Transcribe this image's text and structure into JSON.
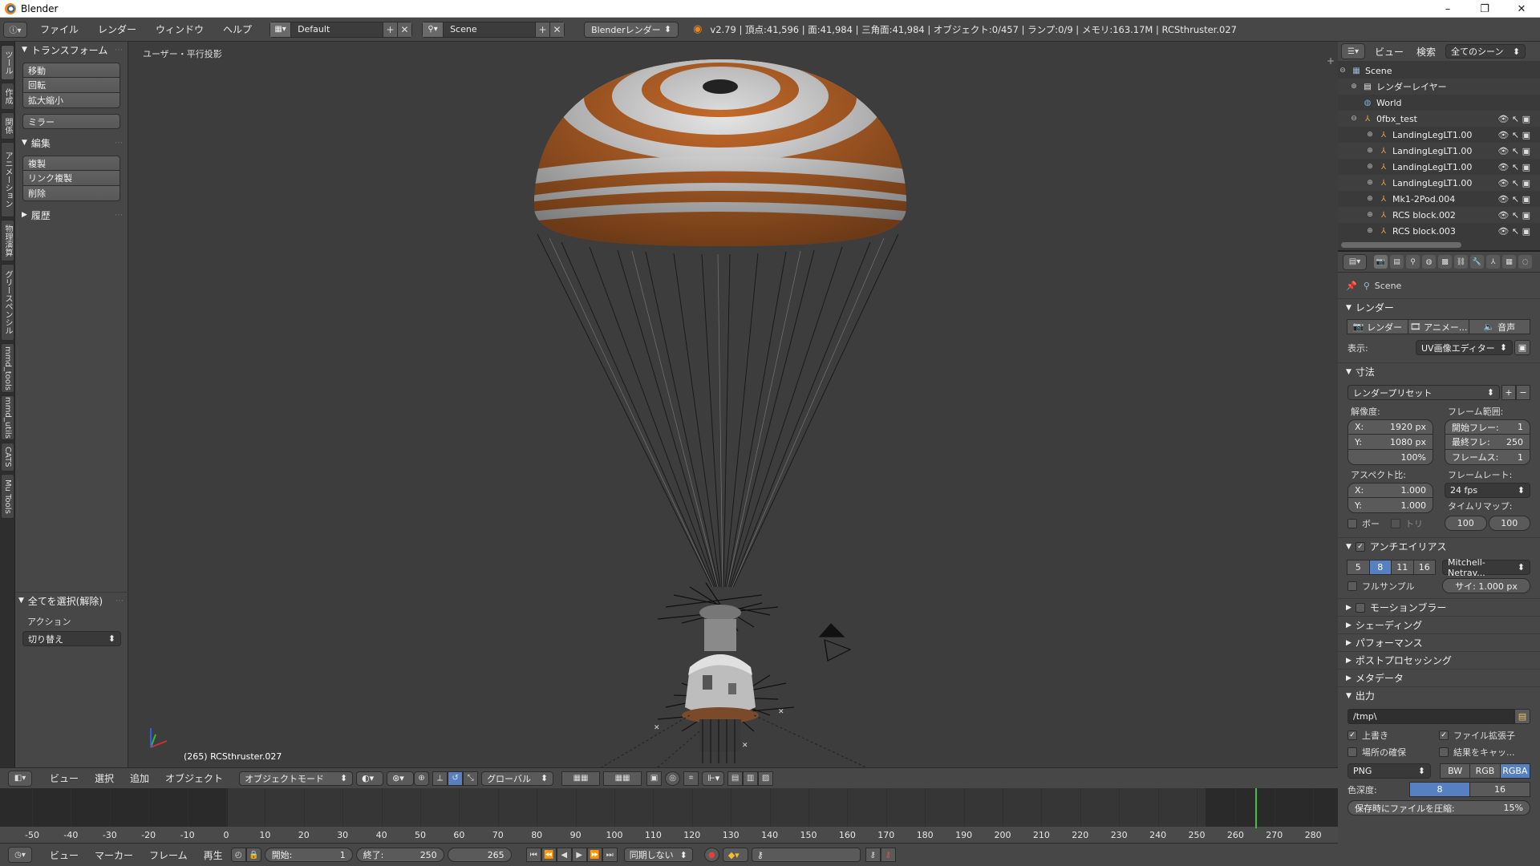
{
  "window": {
    "title": "Blender",
    "minimize": "–",
    "maximize": "❐",
    "close": "✕"
  },
  "info_header": {
    "menus": [
      "ファイル",
      "レンダー",
      "ウィンドウ",
      "ヘルプ"
    ],
    "screen_layout": "Default",
    "scene": "Scene",
    "render_engine": "Blenderレンダー",
    "stats": "v2.79 | 頂点:41,596 | 面:41,984 | 三角面:41,984 | オブジェクト:0/457 | ランプ:0/9 | メモリ:163.17M | RCSthruster.027"
  },
  "shelf_tabs": [
    "ツール",
    "作成",
    "関係",
    "アニメーション",
    "物理演算",
    "グリースペンシル",
    "mmd_tools",
    "mmd_utils",
    "CATS",
    "Mu Tools"
  ],
  "toolshelf": {
    "transform_title": "トランスフォーム",
    "transform_buttons": [
      "移動",
      "回転",
      "拡大縮小"
    ],
    "mirror": "ミラー",
    "edit_title": "編集",
    "edit_buttons": [
      "複製",
      "リンク複製",
      "削除"
    ],
    "history_title": "履歴",
    "select_all_title": "全てを選択(解除)",
    "action_label": "アクション",
    "action_value": "切り替え"
  },
  "viewport": {
    "view_label": "ユーザー・平行投影",
    "object_label": "(265) RCSthruster.027"
  },
  "viewport_header": {
    "menus": [
      "ビュー",
      "選択",
      "追加",
      "オブジェクト"
    ],
    "mode": "オブジェクトモード",
    "orientation": "グローバル"
  },
  "timeline": {
    "ticks": [
      "-50",
      "-40",
      "-30",
      "-20",
      "-10",
      "0",
      "10",
      "20",
      "30",
      "40",
      "50",
      "60",
      "70",
      "80",
      "90",
      "100",
      "110",
      "120",
      "130",
      "140",
      "150",
      "160",
      "170",
      "180",
      "190",
      "200",
      "210",
      "220",
      "230",
      "240",
      "250",
      "260",
      "270",
      "280"
    ],
    "current_frame_value": 265
  },
  "timeline_header": {
    "menus": [
      "ビュー",
      "マーカー",
      "フレーム",
      "再生"
    ],
    "start_label": "開始:",
    "start_value": "1",
    "end_label": "終了:",
    "end_value": "250",
    "current_frame": "265",
    "sync": "同期しない"
  },
  "outliner": {
    "header": {
      "view": "ビュー",
      "search": "検索",
      "filter": "全てのシーン"
    },
    "rows": [
      {
        "name": "Scene",
        "icon": "scene-icon"
      },
      {
        "name": "レンダーレイヤー",
        "icon": "render-layer-icon"
      },
      {
        "name": "World",
        "icon": "world-icon"
      },
      {
        "name": "0fbx_test",
        "icon": "empty-icon"
      },
      {
        "name": "LandingLegLT1.00",
        "icon": "empty-icon"
      },
      {
        "name": "LandingLegLT1.00",
        "icon": "empty-icon"
      },
      {
        "name": "LandingLegLT1.00",
        "icon": "empty-icon"
      },
      {
        "name": "LandingLegLT1.00",
        "icon": "empty-icon"
      },
      {
        "name": "Mk1-2Pod.004",
        "icon": "empty-icon"
      },
      {
        "name": "RCS block.002",
        "icon": "empty-icon"
      },
      {
        "name": "RCS block.003",
        "icon": "empty-icon"
      }
    ]
  },
  "properties": {
    "context": "Scene",
    "render_section": "レンダー",
    "render_btn": "レンダー",
    "anim_btn": "アニメー...",
    "audio_btn": "音声",
    "display_label": "表示:",
    "display_value": "UV画像エディター",
    "dimensions_section": "寸法",
    "render_preset": "レンダープリセット",
    "resolution_label": "解像度:",
    "res_x": "X:",
    "res_x_val": "1920 px",
    "res_y": "Y:",
    "res_y_val": "1080 px",
    "res_pct": "100%",
    "frame_range_label": "フレーム範囲:",
    "frame_start": "開始フレー:",
    "frame_start_val": "1",
    "frame_end": "最終フレ:",
    "frame_end_val": "250",
    "frame_step": "フレームス:",
    "frame_step_val": "1",
    "aspect_label": "アスペクト比:",
    "aspect_x": "X:",
    "aspect_x_val": "1.000",
    "aspect_y": "Y:",
    "aspect_y_val": "1.000",
    "framerate_label": "フレームレート:",
    "framerate": "24 fps",
    "timeremap_label": "タイムリマップ:",
    "timeremap_old": "100",
    "timeremap_new": "100",
    "border": "ボー",
    "crop": "トリ",
    "aa_section": "アンチエイリアス",
    "aa_samples": [
      "5",
      "8",
      "11",
      "16"
    ],
    "aa_filter": "Mitchell-Netrav...",
    "full_sample": "フルサンプル",
    "filter_size": "サイ: 1.000 px",
    "motion_blur": "モーションブラー",
    "shading": "シェーディング",
    "performance": "パフォーマンス",
    "post_processing": "ポストプロセッシング",
    "metadata": "メタデータ",
    "output_section": "出力",
    "output_path": "/tmp\\",
    "overwrite": "上書き",
    "file_ext": "ファイル拡張子",
    "placeholders": "場所の確保",
    "cache_result": "結果をキャッ...",
    "file_format": "PNG",
    "color_modes": [
      "BW",
      "RGB",
      "RGBA"
    ],
    "color_depth_label": "色深度:",
    "color_depths": [
      "8",
      "16"
    ],
    "compression_label": "保存時にファイルを圧縮:",
    "compression_val": "15%"
  },
  "colors": {
    "accent": "#5680c2",
    "parachute_orange": "#c46a2a",
    "parachute_white": "#e8e8e8",
    "timeline_cursor": "#3cc23c"
  }
}
